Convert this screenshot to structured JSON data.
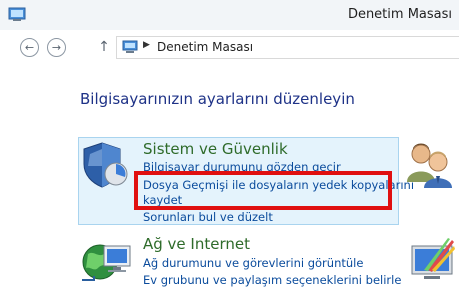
{
  "window": {
    "title": "Denetim Masası"
  },
  "nav": {
    "back": "←",
    "forward": "→",
    "up": "↑"
  },
  "address": {
    "separator": "▶",
    "crumb": "Denetim Masası"
  },
  "main": {
    "heading": "Bilgisayarınızın ayarlarını düzenleyin",
    "categories": [
      {
        "title": "Sistem ve Güvenlik",
        "icon": "shield-icon",
        "links": [
          "Bilgisayar durumunu gözden geçir",
          "Dosya Geçmişi ile dosyaların yedek kopyalarını",
          "kaydet",
          "Sorunları bul ve düzelt"
        ]
      },
      {
        "title": "Ağ ve Internet",
        "icon": "network-globe-icon",
        "links": [
          "Ağ durumunu ve görevlerini görüntüle",
          "Ev grubunu ve paylaşım seçeneklerini belirle"
        ]
      }
    ],
    "right_icons": [
      "user-accounts-icon",
      "appearance-icon"
    ]
  },
  "colors": {
    "heading": "#1e3287",
    "category_title": "#2e6b2a",
    "link": "#0a4b9c",
    "highlight_border": "#e01010",
    "hover_bg": "#e4f3fc"
  }
}
